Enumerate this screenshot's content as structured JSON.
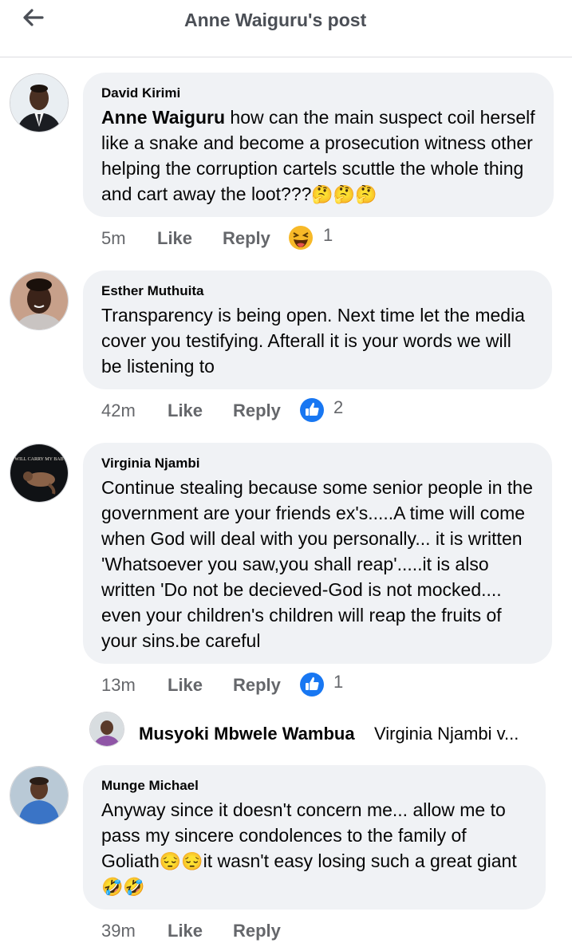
{
  "header": {
    "title": "Anne Waiguru's post",
    "back_icon": "back-arrow-icon"
  },
  "comments": [
    {
      "author": "David Kirimi",
      "mention": "Anne Waiguru",
      "text": " how can the main suspect coil herself like a snake and become a prosecution witness other helping the corruption cartels scuttle the whole thing and cart away the loot???",
      "emoji": "🤔🤔🤔",
      "time": "5m",
      "like": "Like",
      "reply": "Reply",
      "reaction": "laughing-emoji-icon",
      "reaction_count": "1"
    },
    {
      "author": "Esther Muthuita",
      "text": "Transparency is being open. Next time let the media cover you testifying. Afterall it is your words we will be listening to",
      "time": "42m",
      "like": "Like",
      "reply": "Reply",
      "reaction": "thumbs-up-icon",
      "reaction_count": "2"
    },
    {
      "author": "Virginia Njambi",
      "avatar_caption": "WILL CARRY MY BAB",
      "text": "Continue stealing because some senior people in the government are your friends ex's.....A time will come when God will deal with you personally... it is written 'Whatsoever you saw,you shall reap'.....it is also written 'Do not be decieved-God is not mocked.... even your children's children will reap the fruits of your sins.be careful",
      "time": "13m",
      "like": "Like",
      "reply": "Reply",
      "reaction": "thumbs-up-icon",
      "reaction_count": "1",
      "reply_preview": {
        "author": "Musyoki Mbwele Wambua",
        "snippet": "Virginia Njambi v..."
      }
    },
    {
      "author": "Munge Michael",
      "text": "Anyway since it doesn't concern me... allow me to pass my sincere condolences to the family of Goliath",
      "emoji1": "😔😔",
      "text2": "it wasn't easy losing such a great giant",
      "emoji2": "🤣🤣",
      "time": "39m",
      "like": "Like",
      "reply": "Reply"
    }
  ],
  "colors": {
    "bubble": "#f0f2f5",
    "meta": "#65676b",
    "like_blue": "#1877f2"
  }
}
